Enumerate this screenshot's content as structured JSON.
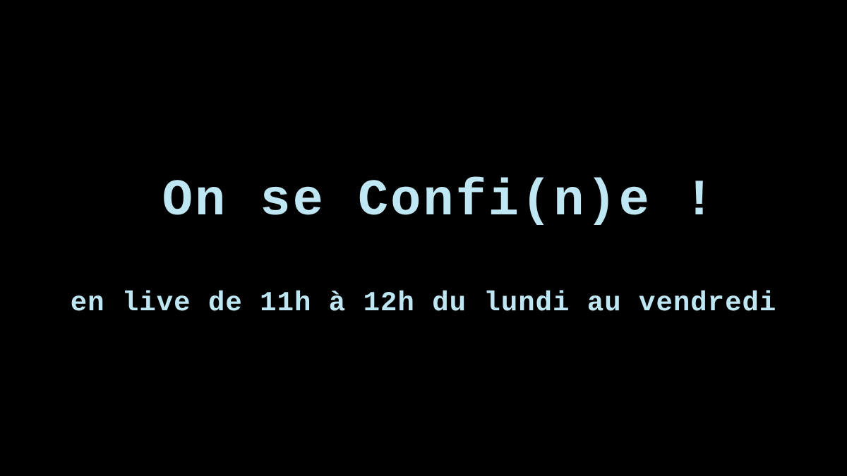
{
  "title": "On se Confi(n)e !",
  "subtitle": "en live de 11h à 12h du lundi au vendredi",
  "colors": {
    "background": "#000000",
    "text": "#bfe6f3"
  }
}
